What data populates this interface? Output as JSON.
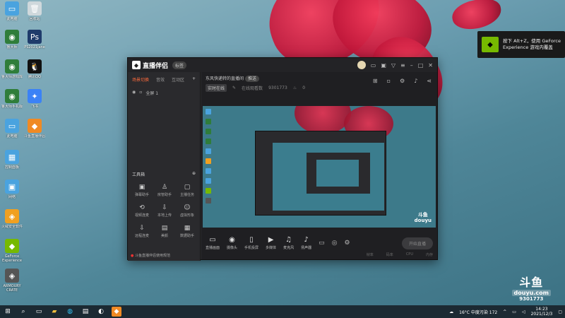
{
  "desktop": {
    "icons": [
      {
        "label": "此电脑",
        "color": "#4aa3df",
        "glyph": "▭"
      },
      {
        "label": "回收站",
        "color": "#cfd8dc",
        "glyph": "🗑"
      },
      {
        "label": "鲁大师",
        "color": "#2f7d3a",
        "glyph": "◉"
      },
      {
        "label": "PS2021jane",
        "color": "#1f3b6b",
        "glyph": "Ps"
      },
      {
        "label": "鲁大师游戏库",
        "color": "#2f7d3a",
        "glyph": "◉"
      },
      {
        "label": "腾讯QQ",
        "color": "#111",
        "glyph": "🐧"
      },
      {
        "label": "鲁大师手机版",
        "color": "#2f7d3a",
        "glyph": "◉"
      },
      {
        "label": "飞书",
        "color": "#3b82f6",
        "glyph": "✦"
      },
      {
        "label": "此电脑",
        "color": "#4aa3df",
        "glyph": "▭"
      },
      {
        "label": "斗鱼直播伴侣",
        "color": "#f08a24",
        "glyph": "◆"
      },
      {
        "label": "控制面板",
        "color": "#4aa3df",
        "glyph": "▦"
      },
      {
        "label": "网络",
        "color": "#4aa3df",
        "glyph": "▣"
      },
      {
        "label": "火绒安全软件",
        "color": "#f0a020",
        "glyph": "◈"
      },
      {
        "label": "GeForce Experience",
        "color": "#76b900",
        "glyph": "◆"
      },
      {
        "label": "ARMOURY CRATE",
        "color": "#555",
        "glyph": "◈"
      }
    ]
  },
  "toast": {
    "line1": "按下 Alt+Z，使用 GeForce",
    "line2": "Experience 游戏内覆盖"
  },
  "app": {
    "title": "直播伴侣",
    "badge": "标签",
    "tabs": [
      "场景切换",
      "音效",
      "互动区"
    ],
    "scene": "全屏 1",
    "room_title": "东风快递转的直播间",
    "room_tag": "推送",
    "room_sub": {
      "live": "实时在线",
      "status": "在线观看数",
      "views": "9301773",
      "likes": "0"
    },
    "tools_header": "工具箱",
    "tools": [
      {
        "label": "弹幕助手",
        "glyph": "▣"
      },
      {
        "label": "房管助手",
        "glyph": "♙"
      },
      {
        "label": "主播任务",
        "glyph": "▢"
      },
      {
        "label": "视频连麦",
        "glyph": "⟲"
      },
      {
        "label": "本地上传",
        "glyph": "⇩"
      },
      {
        "label": "虚拟形象",
        "glyph": "☺"
      },
      {
        "label": "远程连麦",
        "glyph": "⇩"
      },
      {
        "label": "美颜",
        "glyph": "▤"
      },
      {
        "label": "数据助手",
        "glyph": "▦"
      }
    ],
    "notice": "斗鱼直播伴侣使用规范",
    "controls": [
      {
        "label": "直播画面",
        "glyph": "▭"
      },
      {
        "label": "摄像头",
        "glyph": "◉"
      },
      {
        "label": "手机投屏",
        "glyph": "▯"
      },
      {
        "label": "多媒体",
        "glyph": "▶"
      },
      {
        "label": "麦克风",
        "glyph": "♫"
      },
      {
        "label": "扬声器",
        "glyph": "♪"
      }
    ],
    "start_label": "开始直播",
    "status": [
      "帧率",
      "码率",
      "CPU",
      "内存"
    ]
  },
  "watermark": {
    "brand": "斗鱼",
    "site": "douyu.com",
    "id": "9301773"
  },
  "taskbar": {
    "weather": "16°C 中度污染 172",
    "time": "14:23",
    "date": "2021/12/3"
  }
}
